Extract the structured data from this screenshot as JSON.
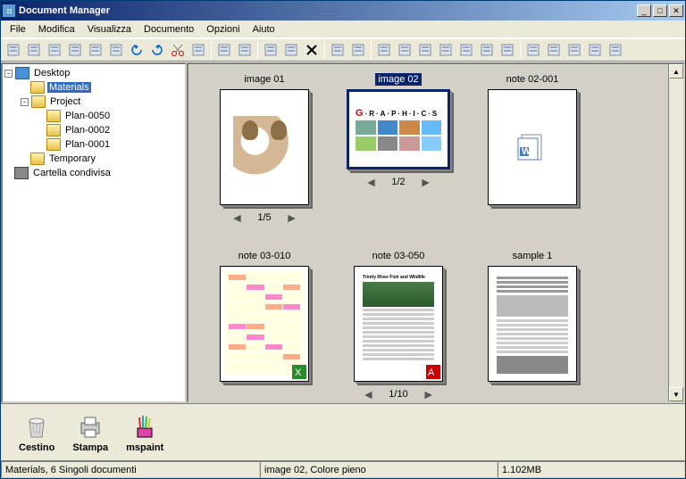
{
  "titlebar": {
    "title": "Document Manager"
  },
  "menu": {
    "items": [
      "File",
      "Modifica",
      "Visualizza",
      "Documento",
      "Opzioni",
      "Aiuto"
    ]
  },
  "toolbar": {
    "icons": [
      "open-icon",
      "save-icon",
      "page-icon",
      "scanner-icon",
      "copy-icon",
      "send-icon",
      "back-icon",
      "forward-icon",
      "cut-icon",
      "paste-icon",
      "sep",
      "find-icon",
      "list-icon",
      "sep",
      "grid-icon",
      "grid2-icon",
      "delete-icon",
      "sep",
      "copy2-icon",
      "paste2-icon",
      "sep",
      "rotate-icon",
      "rotate2-icon",
      "flip-icon",
      "doc-icon",
      "doc2-icon",
      "stack-icon",
      "stack2-icon",
      "sep",
      "gear-icon",
      "gear2-icon",
      "wand-icon",
      "page2-icon",
      "props-icon"
    ]
  },
  "tree": {
    "nodes": [
      {
        "indent": 0,
        "expand": "-",
        "icon": "desktop",
        "label": "Desktop"
      },
      {
        "indent": 1,
        "expand": "",
        "icon": "folder-open",
        "label": "Materials",
        "selected": true
      },
      {
        "indent": 1,
        "expand": "-",
        "icon": "folder-open",
        "label": "Project"
      },
      {
        "indent": 2,
        "expand": "",
        "icon": "folder",
        "label": "Plan-0050"
      },
      {
        "indent": 2,
        "expand": "",
        "icon": "folder",
        "label": "Plan-0002"
      },
      {
        "indent": 2,
        "expand": "",
        "icon": "folder",
        "label": "Plan-0001"
      },
      {
        "indent": 1,
        "expand": "",
        "icon": "folder",
        "label": "Temporary"
      },
      {
        "indent": 0,
        "expand": "",
        "icon": "share",
        "label": "Cartella condivisa"
      }
    ]
  },
  "thumbs": [
    {
      "name": "image 01",
      "pager": "1/5",
      "kind": "puppy",
      "selected": false,
      "shape": "tall"
    },
    {
      "name": "image 02",
      "pager": "1/2",
      "kind": "graphics",
      "selected": true,
      "shape": "short"
    },
    {
      "name": "note 02-001",
      "pager": "",
      "kind": "word",
      "selected": false,
      "shape": "tall"
    },
    {
      "name": "note 03-010",
      "pager": "",
      "kind": "spreadsheet",
      "selected": false,
      "shape": "tall"
    },
    {
      "name": "note 03-050",
      "pager": "1/10",
      "kind": "pdf-article",
      "selected": false,
      "shape": "tall"
    },
    {
      "name": "sample 1",
      "pager": "",
      "kind": "article",
      "selected": false,
      "shape": "tall"
    }
  ],
  "launch": [
    {
      "name": "trash-icon",
      "label": "Cestino"
    },
    {
      "name": "printer-icon",
      "label": "Stampa"
    },
    {
      "name": "mspaint-icon",
      "label": "mspaint"
    }
  ],
  "status": {
    "cell1": "Materials, 6 Singoli documenti",
    "cell2": "image 02, Colore pieno",
    "cell3": "1.102MB"
  }
}
